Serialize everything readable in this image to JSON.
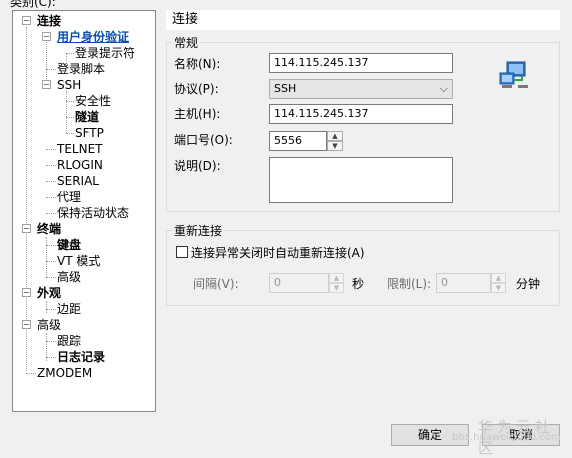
{
  "window": {
    "category_label": "类别(C):"
  },
  "tree": {
    "items": [
      {
        "label": "连接"
      },
      {
        "label": "用户身份验证"
      },
      {
        "label": "登录提示符"
      },
      {
        "label": "登录脚本"
      },
      {
        "label": "SSH"
      },
      {
        "label": "安全性"
      },
      {
        "label": "隧道"
      },
      {
        "label": "SFTP"
      },
      {
        "label": "TELNET"
      },
      {
        "label": "RLOGIN"
      },
      {
        "label": "SERIAL"
      },
      {
        "label": "代理"
      },
      {
        "label": "保持活动状态"
      },
      {
        "label": "终端"
      },
      {
        "label": "键盘"
      },
      {
        "label": "VT 模式"
      },
      {
        "label": "高级"
      },
      {
        "label": "外观"
      },
      {
        "label": "边距"
      },
      {
        "label": "高级"
      },
      {
        "label": "跟踪"
      },
      {
        "label": "日志记录"
      },
      {
        "label": "ZMODEM"
      }
    ]
  },
  "panel": {
    "title": "连接",
    "general": {
      "label": "常规",
      "name_label": "名称(N):",
      "name_value": "114.115.245.137",
      "protocol_label": "协议(P):",
      "protocol_value": "SSH",
      "host_label": "主机(H):",
      "host_value": "114.115.245.137",
      "port_label": "端口号(O):",
      "port_value": "5556",
      "desc_label": "说明(D):",
      "desc_value": ""
    },
    "reconnect": {
      "label": "重新连接",
      "checkbox_label": "连接异常关闭时自动重新连接(A)",
      "interval_label": "间隔(V):",
      "interval_value": "0",
      "seconds_unit": "秒",
      "limit_label": "限制(L):",
      "limit_value": "0",
      "minutes_unit": "分钟"
    }
  },
  "buttons": {
    "ok": "确定",
    "cancel": "取消"
  },
  "watermark": {
    "text": "华为云社区",
    "url": "bbs.huaweicloud.com"
  }
}
